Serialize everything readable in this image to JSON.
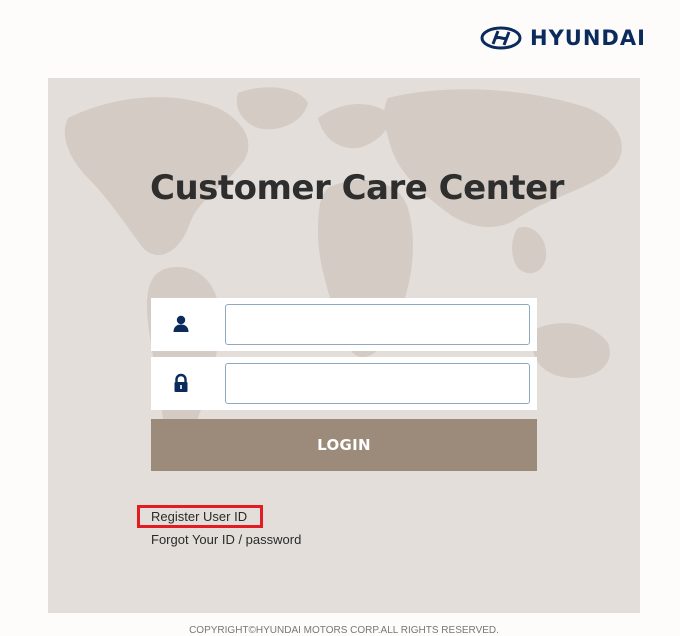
{
  "brand": {
    "name": "HYUNDAI",
    "logo_color": "#0b2b5c"
  },
  "title": "Customer Care Center",
  "login_form": {
    "user_icon": "user-icon",
    "password_icon": "lock-icon",
    "user_id_value": "",
    "password_value": "",
    "login_label": "LOGIN",
    "login_color": "#9c8b7b"
  },
  "links": {
    "register": "Register User ID",
    "forgot": "Forgot Your ID / password",
    "highlight_color": "#e31b23"
  },
  "footer": {
    "copyright": "COPYRIGHT©HYUNDAI MOTORS CORP.ALL RIGHTS RESERVED."
  }
}
